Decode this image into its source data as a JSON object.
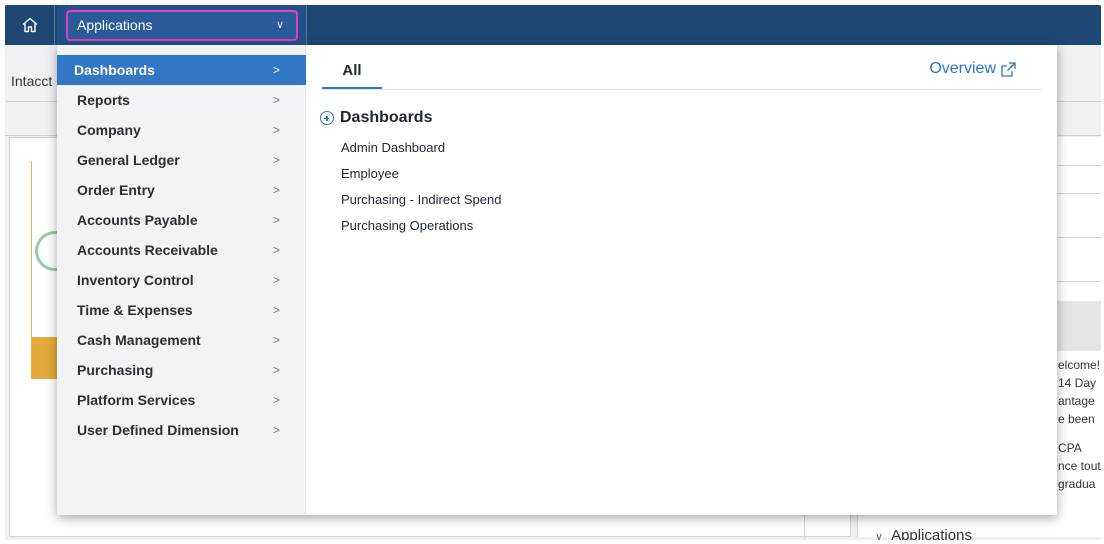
{
  "topbar": {
    "app_selector_label": "Applications",
    "home_icon": "home-icon"
  },
  "background": {
    "breadcrumb_partial": "Intacct",
    "right_panel_lines": [
      "elcome!",
      "14 Day",
      "antage",
      "e been",
      "CPA",
      "nce tout",
      "gradua"
    ],
    "applications_partial": "Applications"
  },
  "menu": {
    "items": [
      {
        "label": "Dashboards",
        "active": true
      },
      {
        "label": "Reports",
        "active": false
      },
      {
        "label": "Company",
        "active": false
      },
      {
        "label": "General Ledger",
        "active": false
      },
      {
        "label": "Order Entry",
        "active": false
      },
      {
        "label": "Accounts Payable",
        "active": false
      },
      {
        "label": "Accounts Receivable",
        "active": false
      },
      {
        "label": "Inventory Control",
        "active": false
      },
      {
        "label": "Time & Expenses",
        "active": false
      },
      {
        "label": "Cash Management",
        "active": false
      },
      {
        "label": "Purchasing",
        "active": false
      },
      {
        "label": "Platform Services",
        "active": false
      },
      {
        "label": "User Defined Dimension",
        "active": false
      }
    ],
    "arrow_glyph": ">"
  },
  "content": {
    "tab_label": "All",
    "overview_label": "Overview",
    "section_title": "Dashboards",
    "links": [
      "Admin Dashboard",
      "Employee",
      "Purchasing - Indirect Spend",
      "Purchasing Operations"
    ]
  },
  "colors": {
    "topbar": "#1f4774",
    "accent": "#3277c6",
    "selector_outline": "#e040c8",
    "link": "#2d73c2"
  }
}
